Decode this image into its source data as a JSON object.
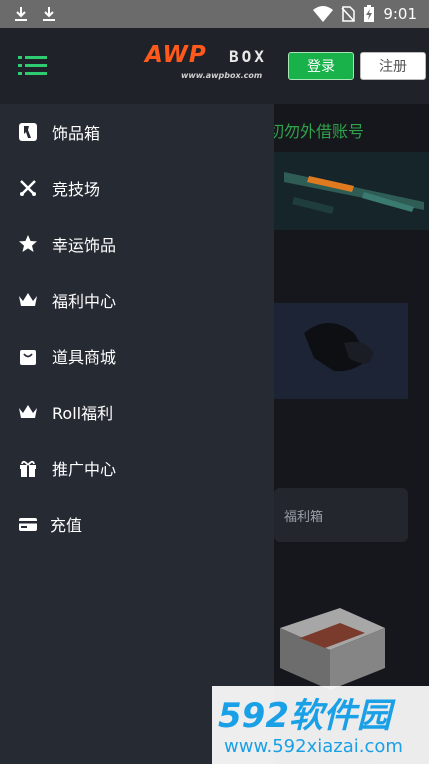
{
  "status_bar": {
    "time": "9:01",
    "icons": [
      "download-icon",
      "download-icon",
      "wifi-icon",
      "no-sim-icon",
      "battery-charging-icon"
    ]
  },
  "header": {
    "logo_main": "AWP",
    "logo_box": "BOX",
    "logo_sub": "www.awpbox.com",
    "login_label": "登录",
    "register_label": "注册",
    "colors": {
      "logo_orange": "#ff5a1c",
      "login_green": "#19b14a"
    }
  },
  "background": {
    "notice_text": "切勿外借账号",
    "card_label": "福利箱"
  },
  "drawer": {
    "items": [
      {
        "label": "饰品箱",
        "icon": "csgo-icon"
      },
      {
        "label": "竞技场",
        "icon": "crossed-swords-icon"
      },
      {
        "label": "幸运饰品",
        "icon": "star-icon"
      },
      {
        "label": "福利中心",
        "icon": "crown-icon"
      },
      {
        "label": "道具商城",
        "icon": "shopping-bag-icon"
      },
      {
        "label": "Roll福利",
        "icon": "crown-icon"
      },
      {
        "label": "推广中心",
        "icon": "gift-icon"
      },
      {
        "label": "充值",
        "icon": "credit-card-icon"
      }
    ]
  },
  "watermark": {
    "top": "592软件园",
    "bottom": "www.592xiazai.com"
  }
}
